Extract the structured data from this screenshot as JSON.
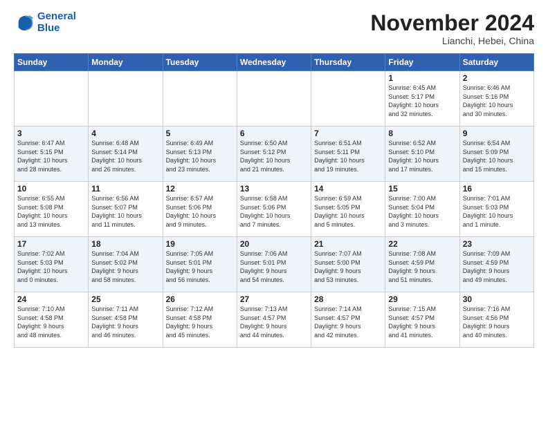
{
  "logo": {
    "line1": "General",
    "line2": "Blue"
  },
  "title": "November 2024",
  "subtitle": "Lianchi, Hebei, China",
  "weekdays": [
    "Sunday",
    "Monday",
    "Tuesday",
    "Wednesday",
    "Thursday",
    "Friday",
    "Saturday"
  ],
  "weeks": [
    [
      {
        "day": "",
        "info": ""
      },
      {
        "day": "",
        "info": ""
      },
      {
        "day": "",
        "info": ""
      },
      {
        "day": "",
        "info": ""
      },
      {
        "day": "",
        "info": ""
      },
      {
        "day": "1",
        "info": "Sunrise: 6:45 AM\nSunset: 5:17 PM\nDaylight: 10 hours\nand 32 minutes."
      },
      {
        "day": "2",
        "info": "Sunrise: 6:46 AM\nSunset: 5:16 PM\nDaylight: 10 hours\nand 30 minutes."
      }
    ],
    [
      {
        "day": "3",
        "info": "Sunrise: 6:47 AM\nSunset: 5:15 PM\nDaylight: 10 hours\nand 28 minutes."
      },
      {
        "day": "4",
        "info": "Sunrise: 6:48 AM\nSunset: 5:14 PM\nDaylight: 10 hours\nand 26 minutes."
      },
      {
        "day": "5",
        "info": "Sunrise: 6:49 AM\nSunset: 5:13 PM\nDaylight: 10 hours\nand 23 minutes."
      },
      {
        "day": "6",
        "info": "Sunrise: 6:50 AM\nSunset: 5:12 PM\nDaylight: 10 hours\nand 21 minutes."
      },
      {
        "day": "7",
        "info": "Sunrise: 6:51 AM\nSunset: 5:11 PM\nDaylight: 10 hours\nand 19 minutes."
      },
      {
        "day": "8",
        "info": "Sunrise: 6:52 AM\nSunset: 5:10 PM\nDaylight: 10 hours\nand 17 minutes."
      },
      {
        "day": "9",
        "info": "Sunrise: 6:54 AM\nSunset: 5:09 PM\nDaylight: 10 hours\nand 15 minutes."
      }
    ],
    [
      {
        "day": "10",
        "info": "Sunrise: 6:55 AM\nSunset: 5:08 PM\nDaylight: 10 hours\nand 13 minutes."
      },
      {
        "day": "11",
        "info": "Sunrise: 6:56 AM\nSunset: 5:07 PM\nDaylight: 10 hours\nand 11 minutes."
      },
      {
        "day": "12",
        "info": "Sunrise: 6:57 AM\nSunset: 5:06 PM\nDaylight: 10 hours\nand 9 minutes."
      },
      {
        "day": "13",
        "info": "Sunrise: 6:58 AM\nSunset: 5:06 PM\nDaylight: 10 hours\nand 7 minutes."
      },
      {
        "day": "14",
        "info": "Sunrise: 6:59 AM\nSunset: 5:05 PM\nDaylight: 10 hours\nand 5 minutes."
      },
      {
        "day": "15",
        "info": "Sunrise: 7:00 AM\nSunset: 5:04 PM\nDaylight: 10 hours\nand 3 minutes."
      },
      {
        "day": "16",
        "info": "Sunrise: 7:01 AM\nSunset: 5:03 PM\nDaylight: 10 hours\nand 1 minute."
      }
    ],
    [
      {
        "day": "17",
        "info": "Sunrise: 7:02 AM\nSunset: 5:03 PM\nDaylight: 10 hours\nand 0 minutes."
      },
      {
        "day": "18",
        "info": "Sunrise: 7:04 AM\nSunset: 5:02 PM\nDaylight: 9 hours\nand 58 minutes."
      },
      {
        "day": "19",
        "info": "Sunrise: 7:05 AM\nSunset: 5:01 PM\nDaylight: 9 hours\nand 56 minutes."
      },
      {
        "day": "20",
        "info": "Sunrise: 7:06 AM\nSunset: 5:01 PM\nDaylight: 9 hours\nand 54 minutes."
      },
      {
        "day": "21",
        "info": "Sunrise: 7:07 AM\nSunset: 5:00 PM\nDaylight: 9 hours\nand 53 minutes."
      },
      {
        "day": "22",
        "info": "Sunrise: 7:08 AM\nSunset: 4:59 PM\nDaylight: 9 hours\nand 51 minutes."
      },
      {
        "day": "23",
        "info": "Sunrise: 7:09 AM\nSunset: 4:59 PM\nDaylight: 9 hours\nand 49 minutes."
      }
    ],
    [
      {
        "day": "24",
        "info": "Sunrise: 7:10 AM\nSunset: 4:58 PM\nDaylight: 9 hours\nand 48 minutes."
      },
      {
        "day": "25",
        "info": "Sunrise: 7:11 AM\nSunset: 4:58 PM\nDaylight: 9 hours\nand 46 minutes."
      },
      {
        "day": "26",
        "info": "Sunrise: 7:12 AM\nSunset: 4:58 PM\nDaylight: 9 hours\nand 45 minutes."
      },
      {
        "day": "27",
        "info": "Sunrise: 7:13 AM\nSunset: 4:57 PM\nDaylight: 9 hours\nand 44 minutes."
      },
      {
        "day": "28",
        "info": "Sunrise: 7:14 AM\nSunset: 4:57 PM\nDaylight: 9 hours\nand 42 minutes."
      },
      {
        "day": "29",
        "info": "Sunrise: 7:15 AM\nSunset: 4:57 PM\nDaylight: 9 hours\nand 41 minutes."
      },
      {
        "day": "30",
        "info": "Sunrise: 7:16 AM\nSunset: 4:56 PM\nDaylight: 9 hours\nand 40 minutes."
      }
    ]
  ]
}
